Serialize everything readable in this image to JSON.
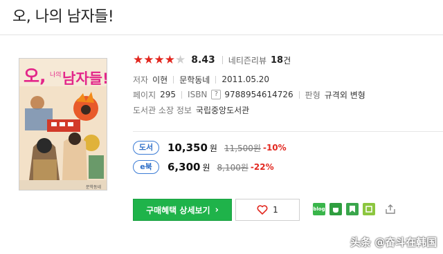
{
  "page": {
    "title": "오, 나의 남자들!"
  },
  "cover": {
    "title_text": "오, 나의 남자들!"
  },
  "rating": {
    "stars_filled": 4,
    "stars_total": 5,
    "score": "8.43",
    "netizen_label": "네티즌리뷰",
    "review_count": "18",
    "review_unit": "건"
  },
  "meta": {
    "author_label": "저자",
    "author": "이현",
    "publisher": "문학동네",
    "date": "2011.05.20",
    "pages_label": "페이지",
    "pages": "295",
    "isbn_label": "ISBN",
    "isbn_help": "?",
    "isbn": "9788954614726",
    "format_label": "판형",
    "format": "규격외 변형",
    "library_label": "도서관 소장 정보",
    "library": "국립중앙도서관"
  },
  "prices": [
    {
      "badge": "도서",
      "price": "10,350",
      "won": "원",
      "original": "11,500원",
      "discount": "-10%"
    },
    {
      "badge": "e북",
      "price": "6,300",
      "won": "원",
      "original": "8,100원",
      "discount": "-22%"
    }
  ],
  "actions": {
    "detail_label": "구매혜택 상세보기",
    "detail_chevron": "›",
    "like_count": "1"
  },
  "share": {
    "blog_label": "blog"
  },
  "watermark": {
    "text": "头条 @奋斗在韩国"
  },
  "colors": {
    "accent_green": "#1fb34a",
    "star_red": "#e2271f",
    "badge_blue": "#2f6fc8",
    "discount_red": "#e2271f"
  }
}
